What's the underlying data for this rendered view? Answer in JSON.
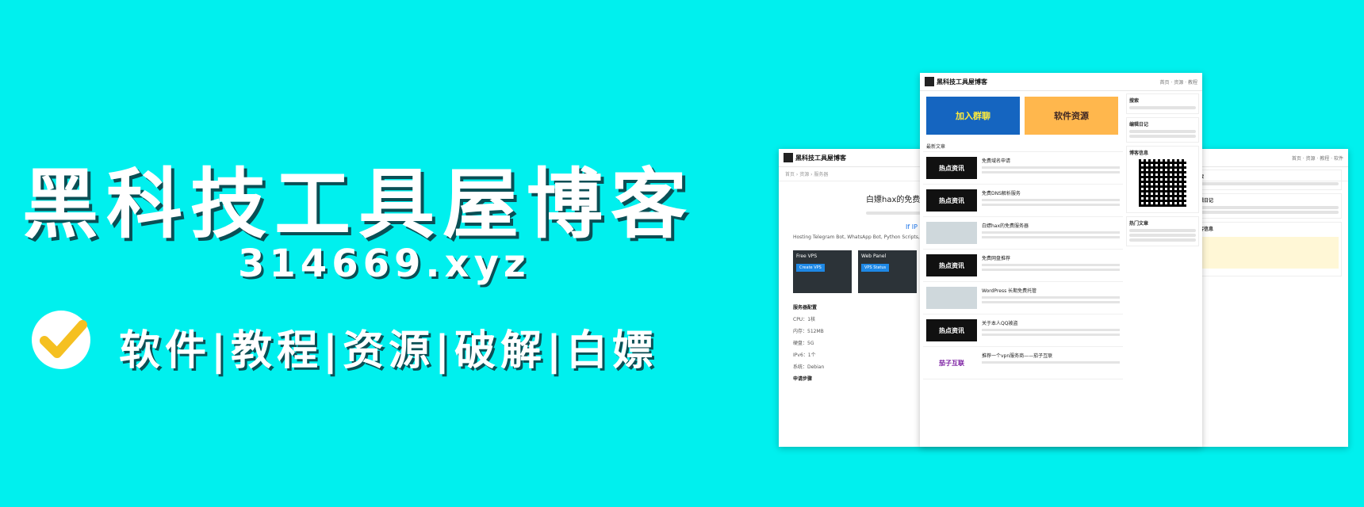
{
  "banner": {
    "title": "黑科技工具屋博客",
    "domain": "314669.xyz",
    "tags": "软件|教程|资源|破解|白嫖"
  },
  "back_screenshot": {
    "logo": "黑科技工具屋博客",
    "article_title": "白嫖hax的免费服务器",
    "blue_line": "If IP address doesn't matter then our se",
    "desc": "Hosting Telegram Bot, WhatsApp Bot, Python Scripts, W",
    "card1": {
      "title": "Free VPS",
      "button": "Create VPS"
    },
    "card2": {
      "title": "Web Panel",
      "button": "VPS Status"
    },
    "section": "服务器配置",
    "specs": [
      "CPU：1核",
      "内存：512MB",
      "硬盘：5G",
      "IPv6：1个",
      "系统：Debian"
    ],
    "section2": "申请步骤",
    "side_label": "搜索",
    "side_label2": "编辑日记",
    "side_label3": "博客信息"
  },
  "front_screenshot": {
    "logo": "黑科技工具屋博客",
    "promo1": "加入群聊",
    "promo2": "软件资源",
    "section": "最新文章",
    "posts": [
      {
        "thumb": "热点资讯",
        "title": "免费域名申请"
      },
      {
        "thumb": "热点资讯",
        "title": "免费DNS解析服务"
      },
      {
        "thumb": "",
        "title": "白嫖hax的免费服务器"
      },
      {
        "thumb": "热点资讯",
        "title": "免费网盘推荐"
      },
      {
        "thumb": "",
        "title": "WordPress 长期免费托管"
      },
      {
        "thumb": "热点资讯",
        "title": "关于本人QQ被盗"
      },
      {
        "thumb": "茄子互联",
        "title": "推荐一个vpn服务商——茄子互联"
      }
    ],
    "widget_search": "搜索",
    "widget_diary": "编辑日记",
    "widget_blog": "博客信息",
    "widget_hot": "热门文章"
  }
}
